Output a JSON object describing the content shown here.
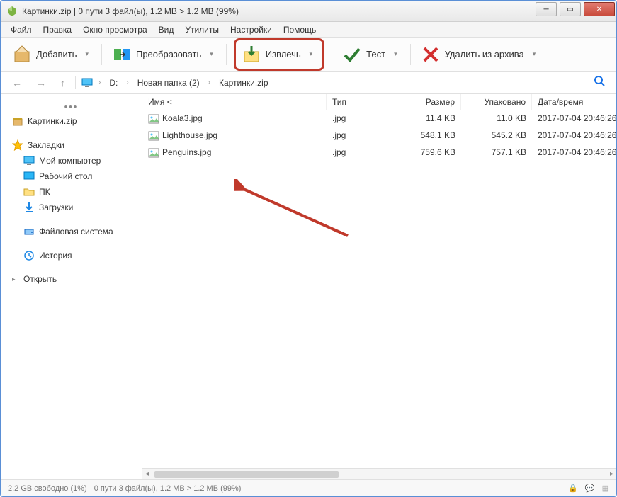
{
  "title": "Картинки.zip | 0 пути 3 файл(ы), 1.2 MB > 1.2 MB (99%)",
  "menubar": [
    "Файл",
    "Правка",
    "Окно просмотра",
    "Вид",
    "Утилиты",
    "Настройки",
    "Помощь"
  ],
  "toolbar": {
    "add": "Добавить",
    "convert": "Преобразовать",
    "extract": "Извлечь",
    "test": "Тест",
    "delete": "Удалить из архива"
  },
  "breadcrumb": {
    "drive": "D:",
    "folder": "Новая папка (2)",
    "archive": "Картинки.zip"
  },
  "sidebar": {
    "archive": "Картинки.zip",
    "bookmarks": "Закладки",
    "mycomputer": "Мой компьютер",
    "desktop": "Рабочий стол",
    "pc": "ПК",
    "downloads": "Загрузки",
    "filesystem": "Файловая система",
    "history": "История",
    "open": "Открыть"
  },
  "columns": {
    "name": "Имя <",
    "type": "Тип",
    "size": "Размер",
    "packed": "Упаковано",
    "date": "Дата/время"
  },
  "files": [
    {
      "name": "Koala3.jpg",
      "type": ".jpg",
      "size": "11.4 KB",
      "packed": "11.0 KB",
      "date": "2017-07-04 20:46:26"
    },
    {
      "name": "Lighthouse.jpg",
      "type": ".jpg",
      "size": "548.1 KB",
      "packed": "545.2 KB",
      "date": "2017-07-04 20:46:26"
    },
    {
      "name": "Penguins.jpg",
      "type": ".jpg",
      "size": "759.6 KB",
      "packed": "757.1 KB",
      "date": "2017-07-04 20:46:26"
    }
  ],
  "statusbar": {
    "free": "2.2 GB свободно (1%)",
    "selection": "0 пути 3 файл(ы), 1.2 MB > 1.2 MB (99%)"
  },
  "colors": {
    "highlight": "#c0392b",
    "accent": "#1a73e8"
  }
}
